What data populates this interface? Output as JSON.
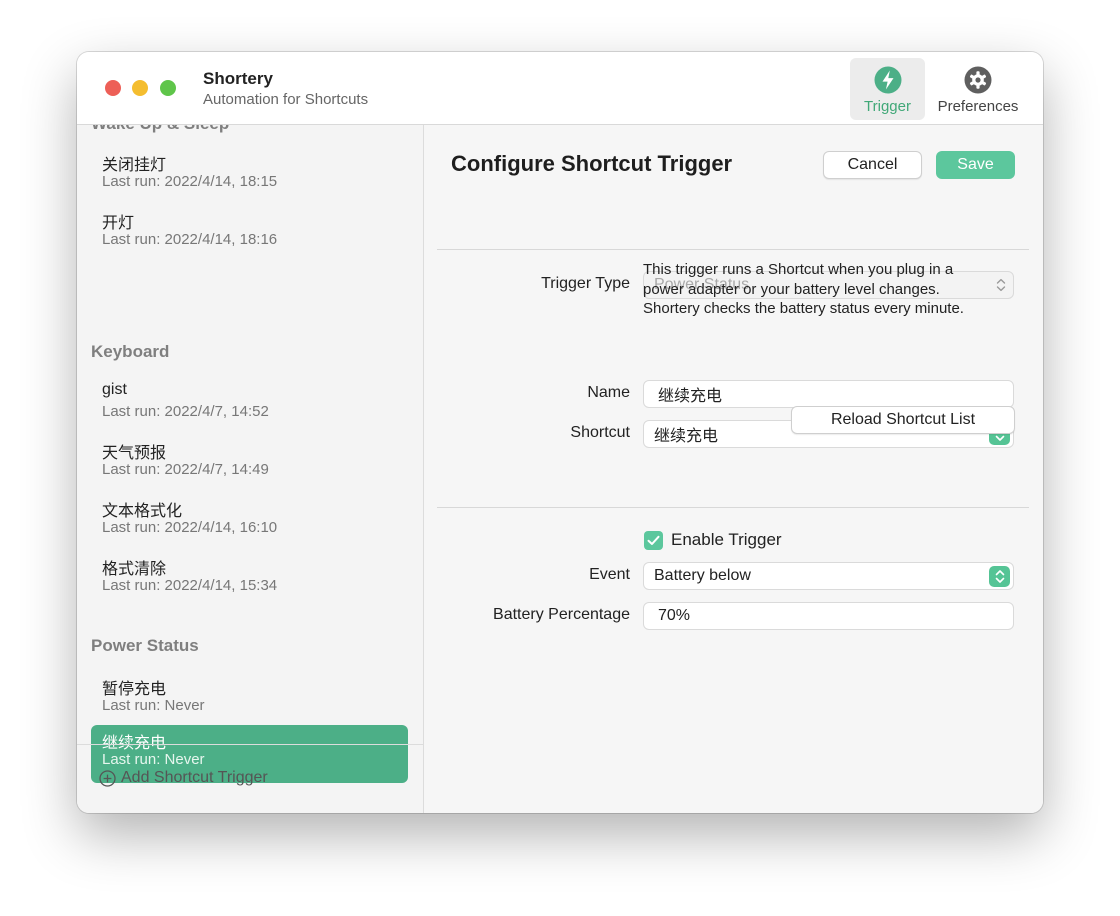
{
  "app": {
    "title": "Shortery",
    "subtitle": "Automation for Shortcuts"
  },
  "toolbar": {
    "trigger_label": "Trigger",
    "trigger_icon": "bolt-icon",
    "preferences_label": "Preferences",
    "preferences_icon": "gear-icon",
    "active_tab": "Trigger",
    "accent": "#4caf87"
  },
  "sidebar": {
    "partial_header": "Wake Up & Sleep",
    "groups": [
      {
        "header": "",
        "items": [
          {
            "name": "关闭挂灯",
            "last_run": "Last run: 2022/4/14, 18:15"
          },
          {
            "name": "开灯",
            "last_run": "Last run: 2022/4/14, 18:16"
          }
        ]
      },
      {
        "header": "Keyboard",
        "items": [
          {
            "name": "gist",
            "last_run": "Last run: 2022/4/7, 14:52"
          },
          {
            "name": "天气预报",
            "last_run": "Last run: 2022/4/7, 14:49"
          },
          {
            "name": "文本格式化",
            "last_run": "Last run: 2022/4/14, 16:10"
          },
          {
            "name": "格式清除",
            "last_run": "Last run: 2022/4/14, 15:34"
          }
        ]
      },
      {
        "header": "Power Status",
        "items": [
          {
            "name": "暂停充电",
            "last_run": "Last run: Never"
          },
          {
            "name": "继续充电",
            "last_run": "Last run: Never",
            "selected": true
          }
        ]
      }
    ],
    "add_label": "Add Shortcut Trigger"
  },
  "config": {
    "title": "Configure Shortcut Trigger",
    "cancel_label": "Cancel",
    "save_label": "Save",
    "trigger_type_label": "Trigger Type",
    "trigger_type_value": "Power Status",
    "description_lines": [
      "This trigger runs a Shortcut when you plug in a",
      "power adapter or your battery level changes.",
      "Shortery checks the battery status every minute."
    ],
    "name_label": "Name",
    "name_value": "继续充电",
    "shortcut_label": "Shortcut",
    "shortcut_value": "继续充电",
    "reload_label": "Reload Shortcut List",
    "enable_label": "Enable Trigger",
    "enable_checked": true,
    "event_label": "Event",
    "event_value": "Battery below",
    "battery_label": "Battery Percentage",
    "battery_value": "70%"
  }
}
